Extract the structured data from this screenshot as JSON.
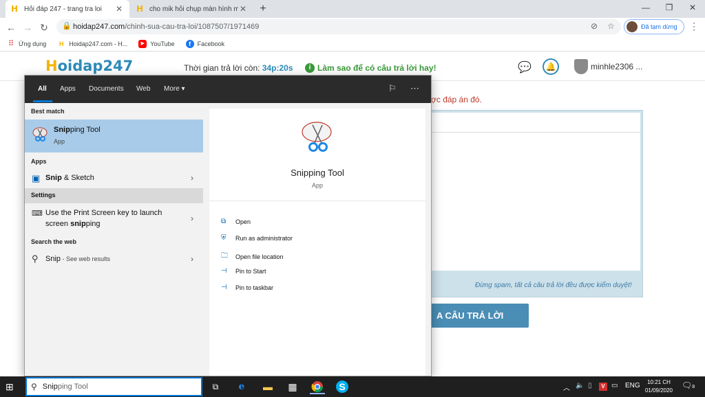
{
  "browser": {
    "tabs": [
      {
        "title": "Hỏi đáp 247 - trang tra loi",
        "favicon": "H",
        "close": "✕"
      },
      {
        "title": "cho mik hỏi chụp màn hình máy",
        "favicon": "H",
        "close": "✕"
      }
    ],
    "new_tab": "+",
    "window_controls": [
      "—",
      "❐",
      "✕"
    ],
    "nav": {
      "back": "←",
      "forward": "→",
      "reload": "↻"
    },
    "url_host": "hoidap247.com",
    "url_path": "/chinh-sua-cau-tra-loi/1087507/1971469",
    "profile_label": "Đã tạm dừng",
    "menu": "⋮",
    "bookmarks": [
      {
        "label": "Ứng dụng",
        "icon": "apps-grid-icon"
      },
      {
        "label": "Hoidap247.com - H...",
        "icon": "hoidap-favicon"
      },
      {
        "label": "YouTube",
        "icon": "youtube-icon"
      },
      {
        "label": "Facebook",
        "icon": "facebook-icon"
      }
    ]
  },
  "site": {
    "logo_prefix": "H",
    "logo_rest": "oidap247",
    "timer_label": "Thời gian trả lời còn: ",
    "timer_value": "34p:20s",
    "tip": "Làm sao để có câu trả lời hay!",
    "username": "minhle2306 ...",
    "warning": "ợc đáp án đó.",
    "spam_note": "Đừng spam, tất cả câu trả lời đều được kiểm duyệt!",
    "submit_label": "A CÂU TRẢ LỜI"
  },
  "search_panel": {
    "tabs": [
      "All",
      "Apps",
      "Documents",
      "Web",
      "More ▾"
    ],
    "best_match_title": "Best match",
    "best_match": {
      "name_bold": "Snip",
      "name_rest": "ping Tool",
      "type": "App"
    },
    "apps_title": "Apps",
    "apps": [
      {
        "name_bold": "Snip",
        "name_rest": " & Sketch"
      }
    ],
    "settings_title": "Settings",
    "settings": [
      {
        "line1": "Use the Print Screen key to launch",
        "line2_pre": "screen ",
        "line2_bold": "snip",
        "line2_rest": "ping"
      }
    ],
    "web_title": "Search the web",
    "web": [
      {
        "name": "Snip",
        "suffix": " - See web results"
      }
    ],
    "preview": {
      "name": "Snipping Tool",
      "type": "App",
      "actions": [
        {
          "label": "Open",
          "icon": "open-icon"
        },
        {
          "label": "Run as administrator",
          "icon": "shield-icon"
        },
        {
          "label": "Open file location",
          "icon": "folder-location-icon"
        },
        {
          "label": "Pin to Start",
          "icon": "pin-icon"
        },
        {
          "label": "Pin to taskbar",
          "icon": "pin-icon"
        }
      ]
    }
  },
  "taskbar": {
    "search_text_bold": "Snip",
    "search_text_rest": "ping Tool",
    "lang": "ENG",
    "time": "10:21 CH",
    "date": "01/09/2020",
    "notif_count": "8"
  },
  "colors": {
    "accent": "#0078d7",
    "brand": "#2e8bb9",
    "selected": "#a8cbe9"
  }
}
